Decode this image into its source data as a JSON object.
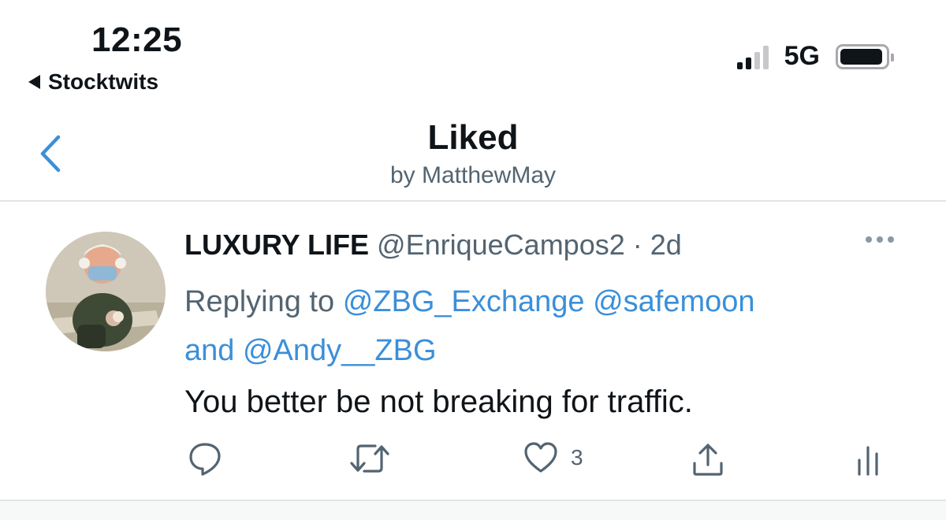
{
  "status_bar": {
    "time": "12:25",
    "back_app_label": "Stocktwits",
    "network": "5G",
    "signal_bars_active": 2,
    "signal_bars_total": 4,
    "battery_level": 0.95
  },
  "header": {
    "title": "Liked",
    "subtitle": "by MatthewMay",
    "back_icon": "chevron-left-icon"
  },
  "tweet": {
    "author_name": "LUXURY LIFE",
    "author_handle": "@EnriqueCampos2",
    "separator": "·",
    "timestamp": "2d",
    "replying_prefix": "Replying to",
    "mention_1": "@ZBG_Exchange",
    "mention_2": "@safemoon",
    "and_word": "and",
    "mention_3": "@Andy__ZBG",
    "text": "You better be not breaking for traffic.",
    "more_icon": "more-options-icon",
    "actions": {
      "reply_icon": "reply-icon",
      "retweet_icon": "retweet-icon",
      "like_icon": "heart-icon",
      "like_count": "3",
      "share_icon": "share-icon",
      "analytics_icon": "analytics-icon"
    }
  },
  "colors": {
    "accent": "#3b8fd9",
    "text_primary": "#0f1419",
    "text_secondary": "#536471",
    "divider": "#e1e4e8"
  }
}
